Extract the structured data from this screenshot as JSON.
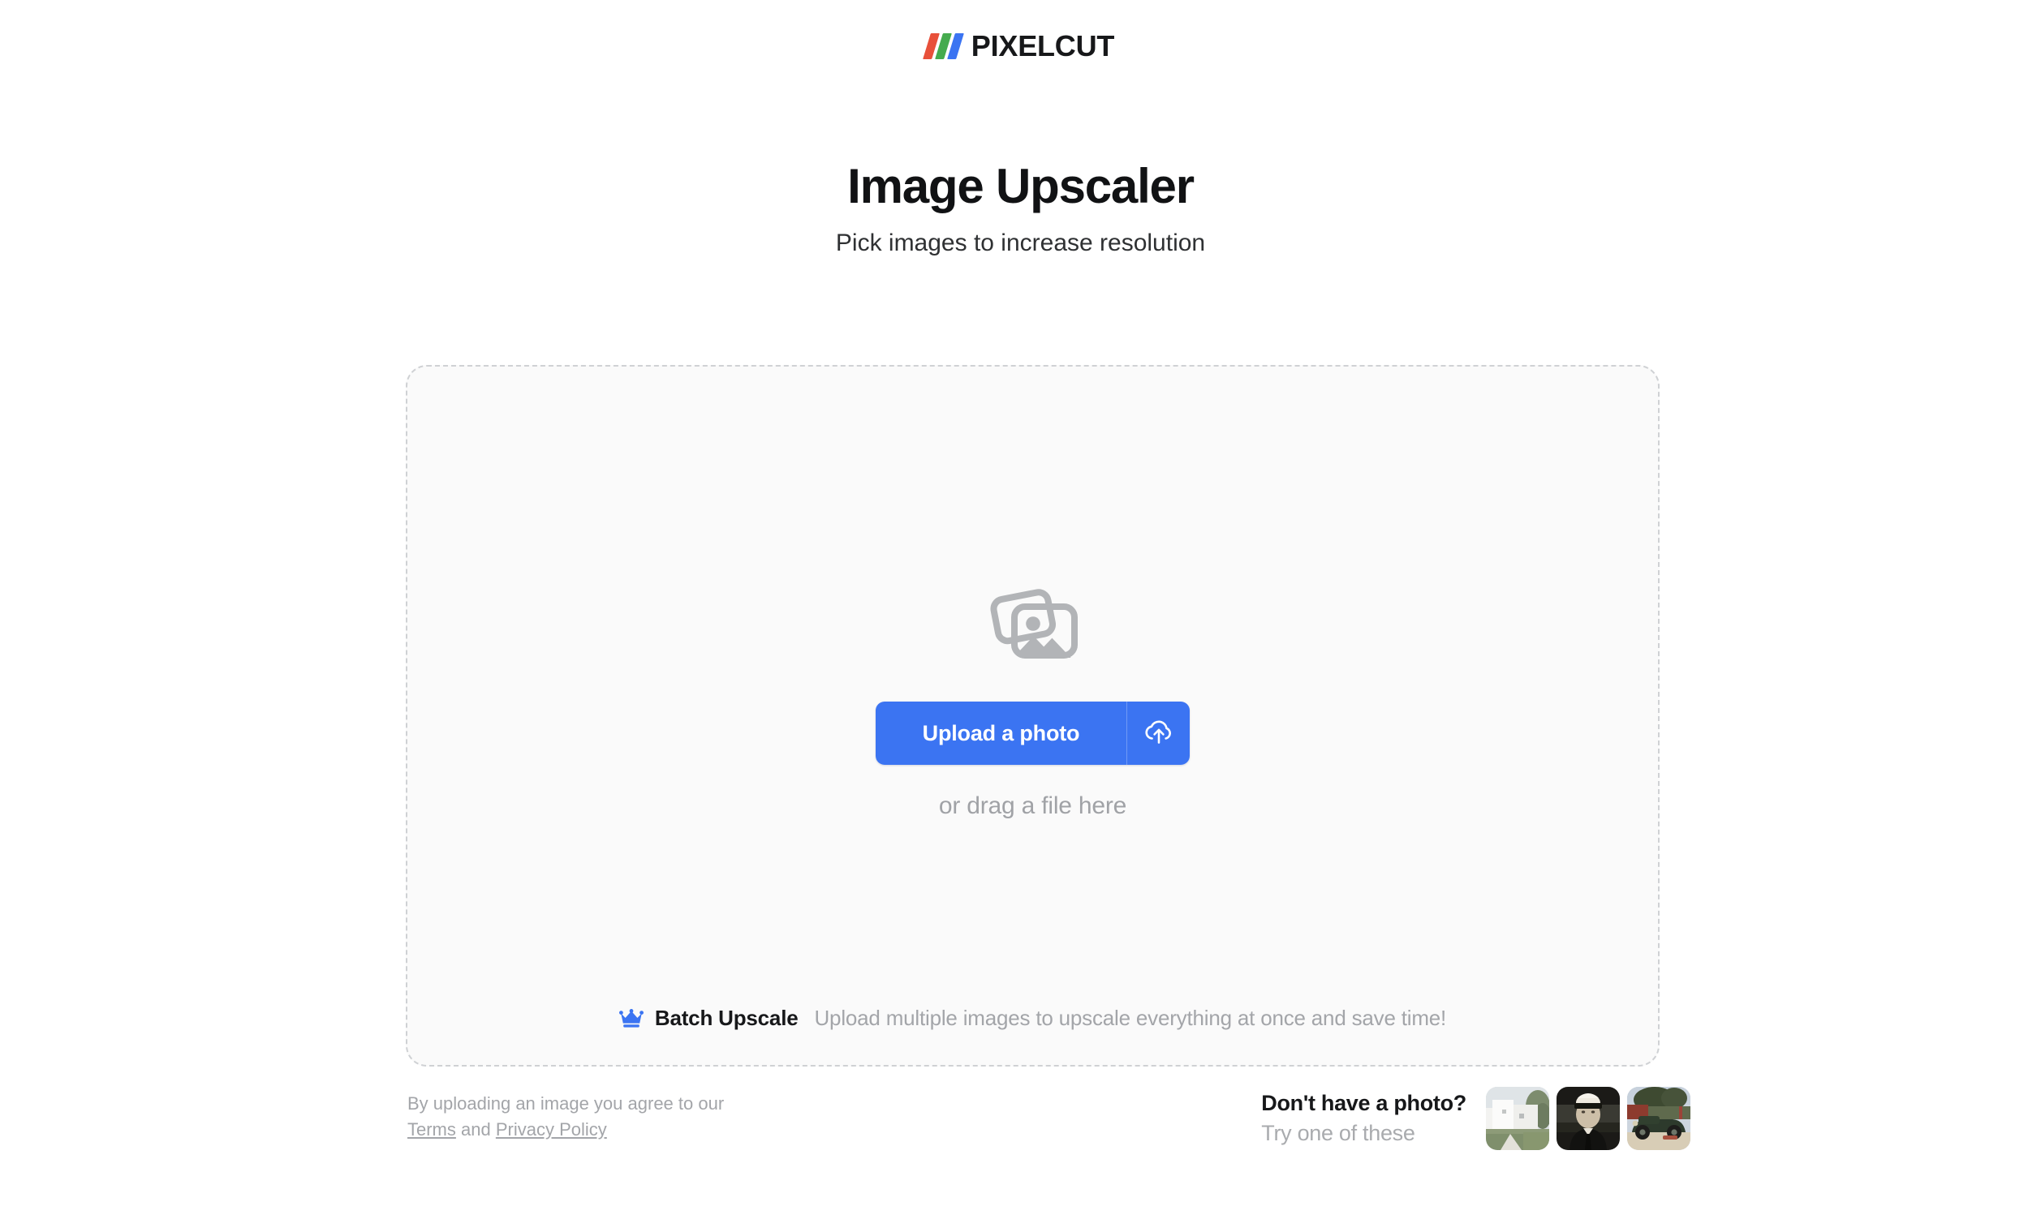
{
  "brand": {
    "name": "PIXELCUT",
    "logo_bar_colors": [
      "#e8503a",
      "#45ab4e",
      "#3b74f2"
    ]
  },
  "hero": {
    "title": "Image Upscaler",
    "subtitle": "Pick images to increase resolution"
  },
  "dropzone": {
    "icon": "photos-stack-icon",
    "upload_button_label": "Upload a photo",
    "upload_icon": "cloud-upload-icon",
    "drag_hint": "or drag a file here",
    "batch": {
      "icon": "crown-icon",
      "title": "Batch Upscale",
      "description": "Upload multiple images to upscale everything at once and save time!"
    }
  },
  "footer": {
    "legal_prefix": "By uploading an image you agree to our",
    "terms_label": "Terms",
    "conjunction": "and",
    "privacy_label": "Privacy Policy",
    "samples_title": "Don't have a photo?",
    "samples_subtitle": "Try one of these",
    "samples": [
      {
        "name": "white-villa-photo"
      },
      {
        "name": "vintage-officer-portrait-photo"
      },
      {
        "name": "vintage-car-photo"
      }
    ]
  },
  "colors": {
    "accent_blue": "#3b74f2",
    "page_background": "#ffffff",
    "dropzone_fill": "#fafafa",
    "dropzone_border": "#cfd1d4",
    "muted_text": "#a3a5a9"
  }
}
